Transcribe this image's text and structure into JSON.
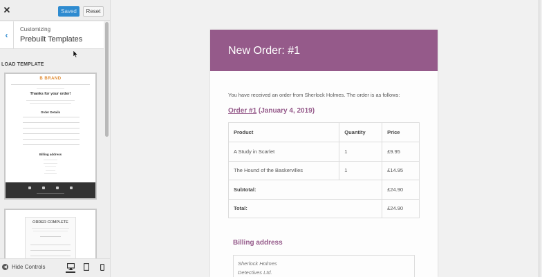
{
  "topbar": {
    "close_label": "✕",
    "saved_label": "Saved",
    "reset_label": "Reset"
  },
  "section": {
    "customizing_label": "Customizing",
    "title": "Prebuilt Templates"
  },
  "load_template_label": "LOAD TEMPLATE",
  "thumbnails": [
    {
      "brand": "B BRAND",
      "heading": "Thanks for your order!",
      "order_details": "Order Details",
      "billing": "Billing address"
    },
    {
      "heading": "ORDER COMPLETE"
    }
  ],
  "bottom": {
    "hide_controls_label": "Hide Controls"
  },
  "email": {
    "title": "New Order: #1",
    "intro": "You have received an order from Sherlock Holmes. The order is as follows:",
    "order_number": "Order #1",
    "order_date": " (January 4, 2019)",
    "columns": [
      "Product",
      "Quantity",
      "Price"
    ],
    "rows": [
      {
        "product": "A Study in Scarlet",
        "qty": "1",
        "price": "£9.95"
      },
      {
        "product": "The Hound of the Baskervilles",
        "qty": "1",
        "price": "£14.95"
      }
    ],
    "subtotal_label": "Subtotal:",
    "subtotal_value": "£24.90",
    "total_label": "Total:",
    "total_value": "£24.90",
    "billing_title": "Billing address",
    "billing_lines": [
      "Sherlock Holmes",
      "Detectives Ltd."
    ]
  },
  "colors": {
    "accent": "#955a8a",
    "saved_button": "#2e8bd0",
    "brand": "#e08a30"
  }
}
